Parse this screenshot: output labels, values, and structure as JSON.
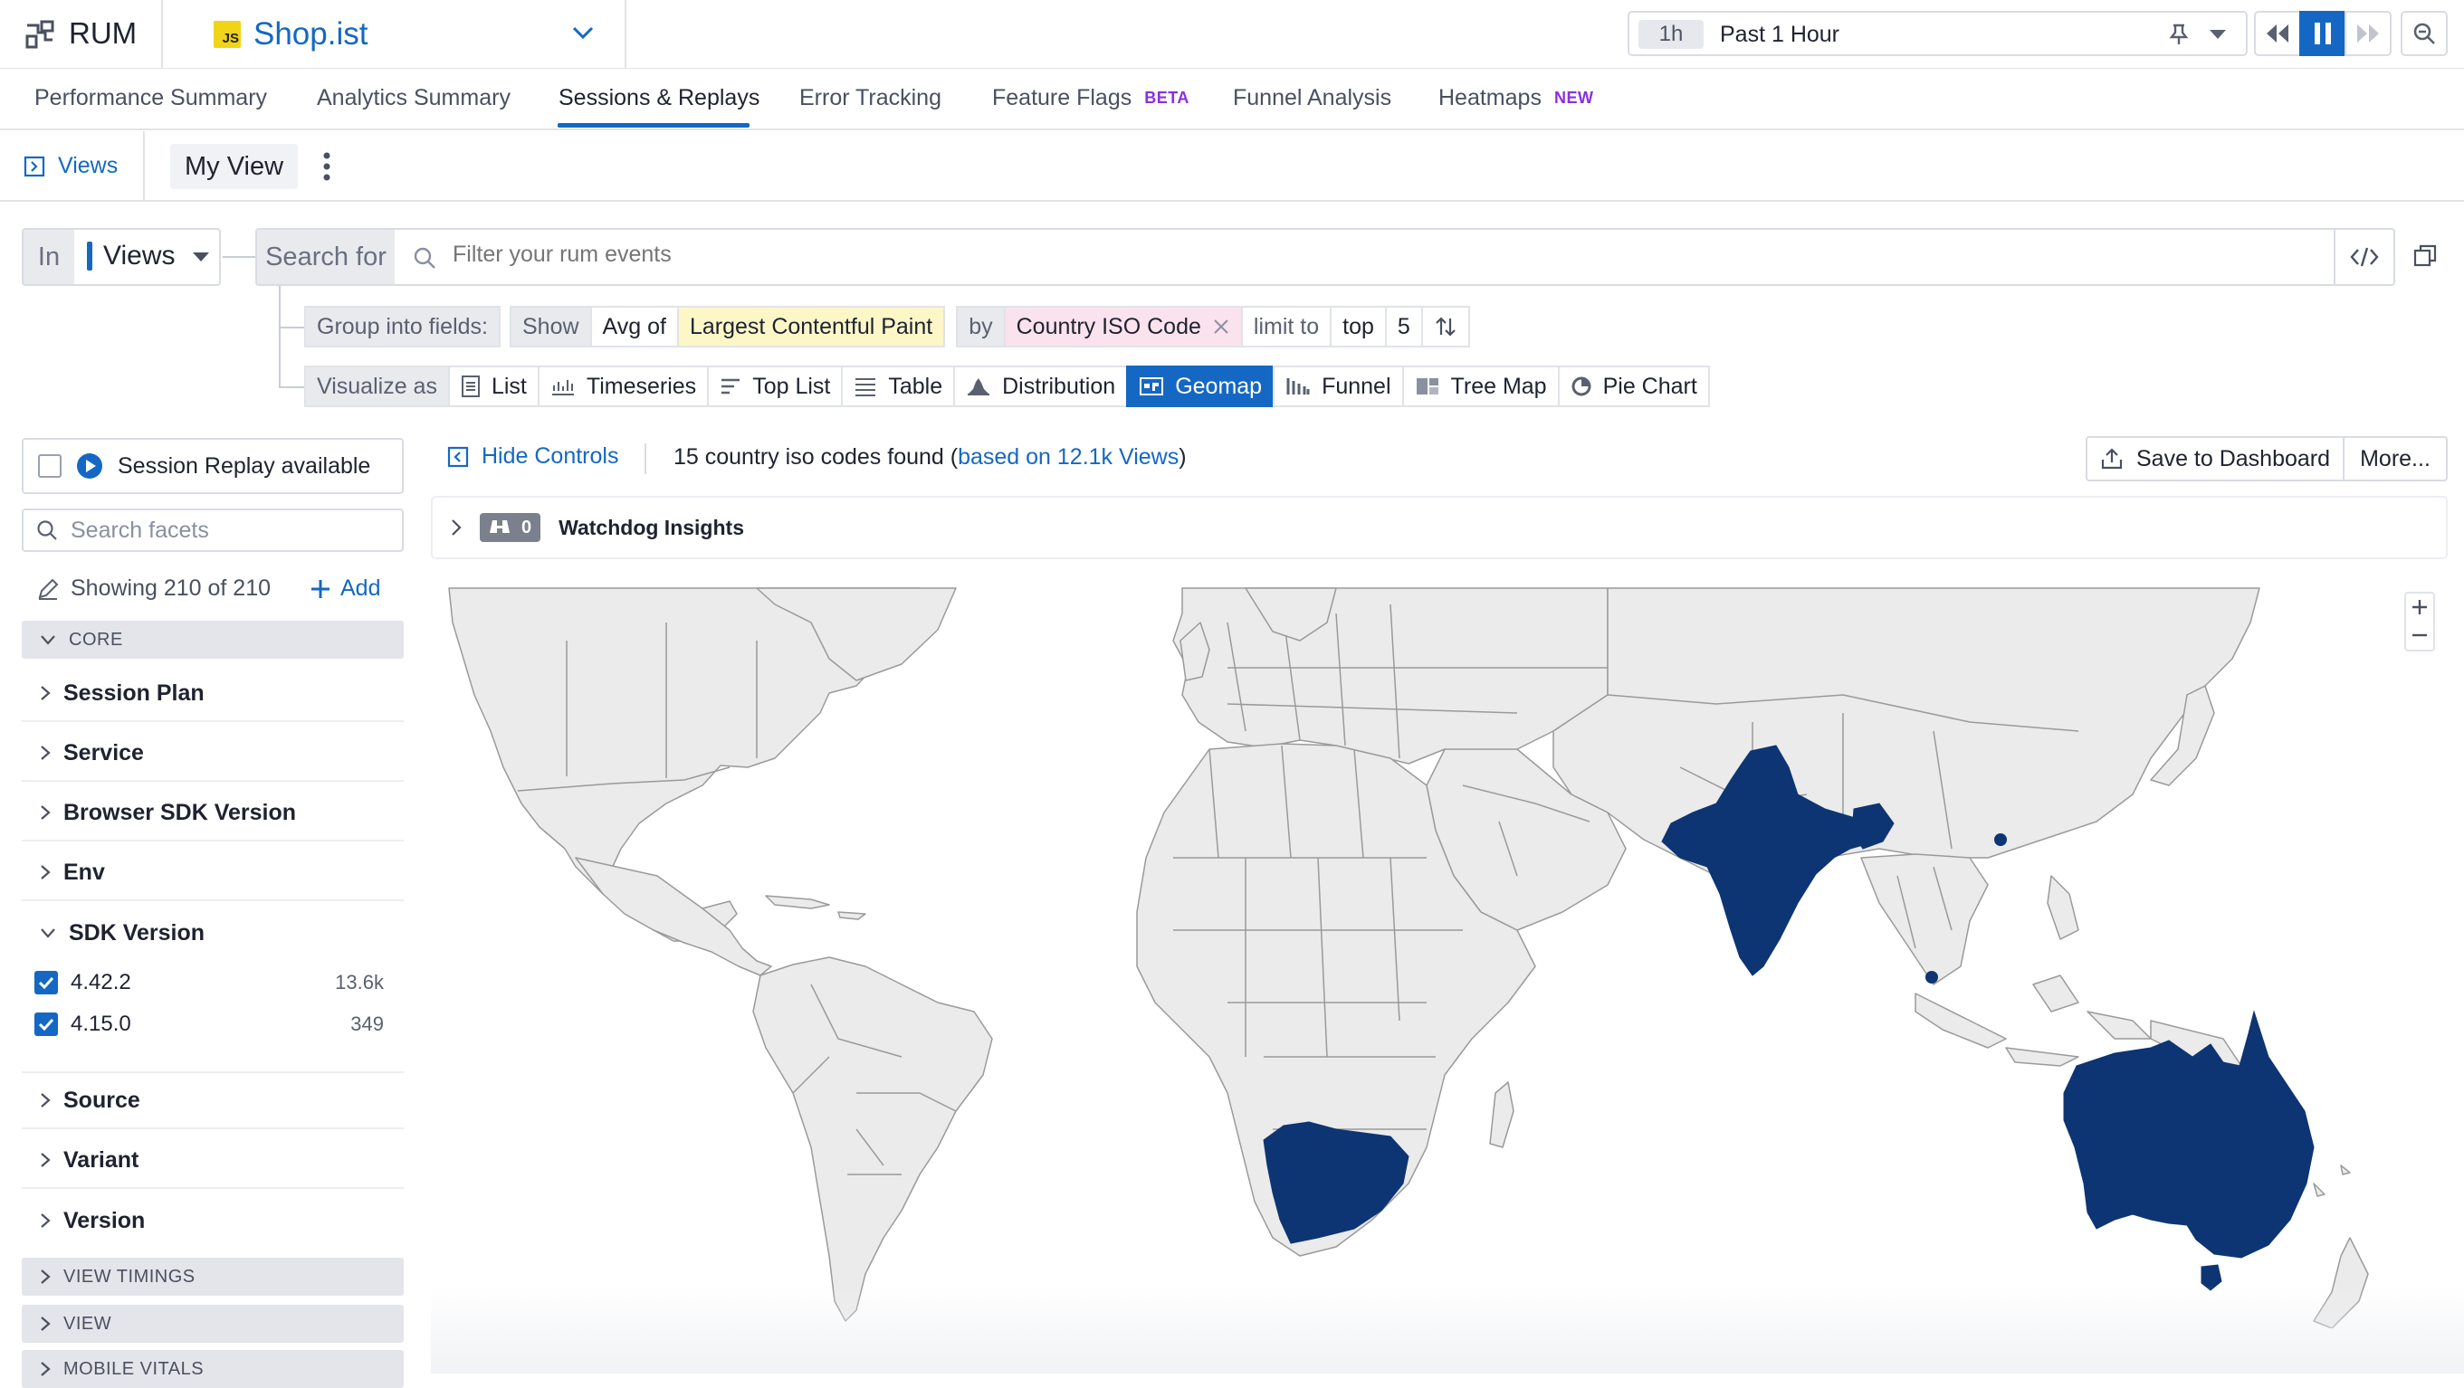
{
  "header": {
    "app_name": "RUM",
    "project_badge": "JS",
    "project_name": "Shop.ist",
    "time_short": "1h",
    "time_label": "Past 1 Hour"
  },
  "tabs": [
    {
      "label": "Performance Summary"
    },
    {
      "label": "Analytics Summary"
    },
    {
      "label": "Sessions & Replays",
      "active": true
    },
    {
      "label": "Error Tracking"
    },
    {
      "label": "Feature Flags",
      "badge": "BETA"
    },
    {
      "label": "Funnel Analysis"
    },
    {
      "label": "Heatmaps",
      "badge": "NEW"
    }
  ],
  "views_row": {
    "views_link": "Views",
    "current_view": "My View"
  },
  "query": {
    "in_label": "In",
    "in_value": "Views",
    "search_for_label": "Search for",
    "search_placeholder": "Filter your rum events",
    "group_into_label": "Group into fields:",
    "show_label": "Show",
    "aggregation": "Avg of",
    "measure": "Largest Contentful Paint",
    "by_label": "by",
    "group_by": "Country ISO Code",
    "limit_label": "limit to",
    "limit_dir": "top",
    "limit_n": "5",
    "visualize_label": "Visualize as",
    "visualizations": [
      "List",
      "Timeseries",
      "Top List",
      "Table",
      "Distribution",
      "Geomap",
      "Funnel",
      "Tree Map",
      "Pie Chart"
    ],
    "active_visualization": "Geomap"
  },
  "facets": {
    "session_replay_label": "Session Replay available",
    "search_placeholder": "Search facets",
    "showing": "Showing 210 of 210",
    "add_label": "Add",
    "core_group": "CORE",
    "items": [
      "Session Plan",
      "Service",
      "Browser SDK Version",
      "Env"
    ],
    "sdk_version": {
      "label": "SDK Version",
      "values": [
        {
          "name": "4.42.2",
          "count": "13.6k"
        },
        {
          "name": "4.15.0",
          "count": "349"
        }
      ]
    },
    "items_after": [
      "Source",
      "Variant",
      "Version"
    ],
    "groups_after": [
      "VIEW TIMINGS",
      "VIEW",
      "MOBILE VITALS"
    ]
  },
  "results": {
    "hide_controls": "Hide Controls",
    "found_text": "15 country iso codes found (",
    "found_link": "based on 12.1k Views",
    "found_end": ")",
    "save_label": "Save to Dashboard",
    "more_label": "More...",
    "watchdog_count": "0",
    "watchdog_title": "Watchdog Insights"
  },
  "map": {
    "highlighted_countries": [
      "India",
      "Bangladesh",
      "South Africa",
      "Australia"
    ],
    "point_markers": [
      "Hong Kong",
      "Singapore"
    ],
    "highlight_color": "#0d3573",
    "land_color": "#ebebeb",
    "border_color": "#9a9a9a"
  },
  "colors": {
    "accent": "#1468c4",
    "badge_purple": "#8b2fe0"
  }
}
